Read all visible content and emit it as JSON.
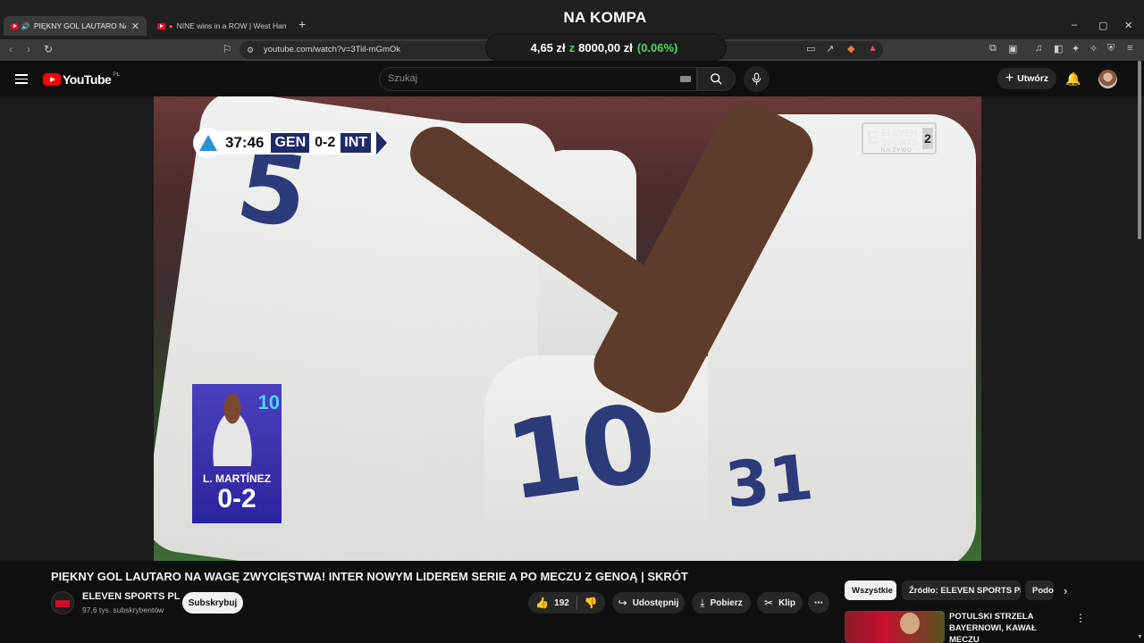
{
  "browser": {
    "tabs": [
      {
        "title": "PIĘKNY GOL LAUTARO NA W",
        "active": true
      },
      {
        "title": "NINE wins in a ROW | West Ham",
        "active": false
      }
    ],
    "url": "youtube.com/watch?v=3Tiil-mGmOk"
  },
  "overlay": {
    "title": "NA KOMPA",
    "price_current": "4,65 zł",
    "price_sep": "z",
    "price_target": "8000,00 zł",
    "price_percent": "(0.06%)"
  },
  "youtube": {
    "logo_text": "YouTube",
    "region": "PL",
    "search_placeholder": "Szukaj",
    "create_label": "Utwórz"
  },
  "video": {
    "scorebug": {
      "time": "37:46",
      "home": "GEN",
      "score": "0-2",
      "away": "INT"
    },
    "broadcaster": {
      "line1": "ELEVEN",
      "line2": "SPORTS",
      "number": "2",
      "sub": "NA ŻYWO"
    },
    "player_card": {
      "number": "10",
      "name": "L. MARTÍNEZ",
      "score": "0-2"
    },
    "title": "PIĘKNY GOL LAUTARO NA WAGĘ ZWYCIĘSTWA! INTER NOWYM LIDEREM SERIE A PO MECZU Z GENOĄ | SKRÓT"
  },
  "channel": {
    "name": "ELEVEN SPORTS PL",
    "subscribers": "97,6 tys. subskrybentów",
    "subscribe_label": "Subskrybuj"
  },
  "actions": {
    "likes": "192",
    "share": "Udostępnij",
    "download": "Pobierz",
    "clip": "Klip"
  },
  "chips": [
    "Wszystkie",
    "Źródło: ELEVEN SPORTS PL",
    "Podo"
  ],
  "recommendation": {
    "title": "POTULSKI STRZELA BAYERNOWI, KAWAŁ MECZU"
  },
  "colors": {
    "youtube_red": "#ff0000",
    "percent_green": "#3ddc66",
    "inter_blue": "#1f2a6b"
  }
}
